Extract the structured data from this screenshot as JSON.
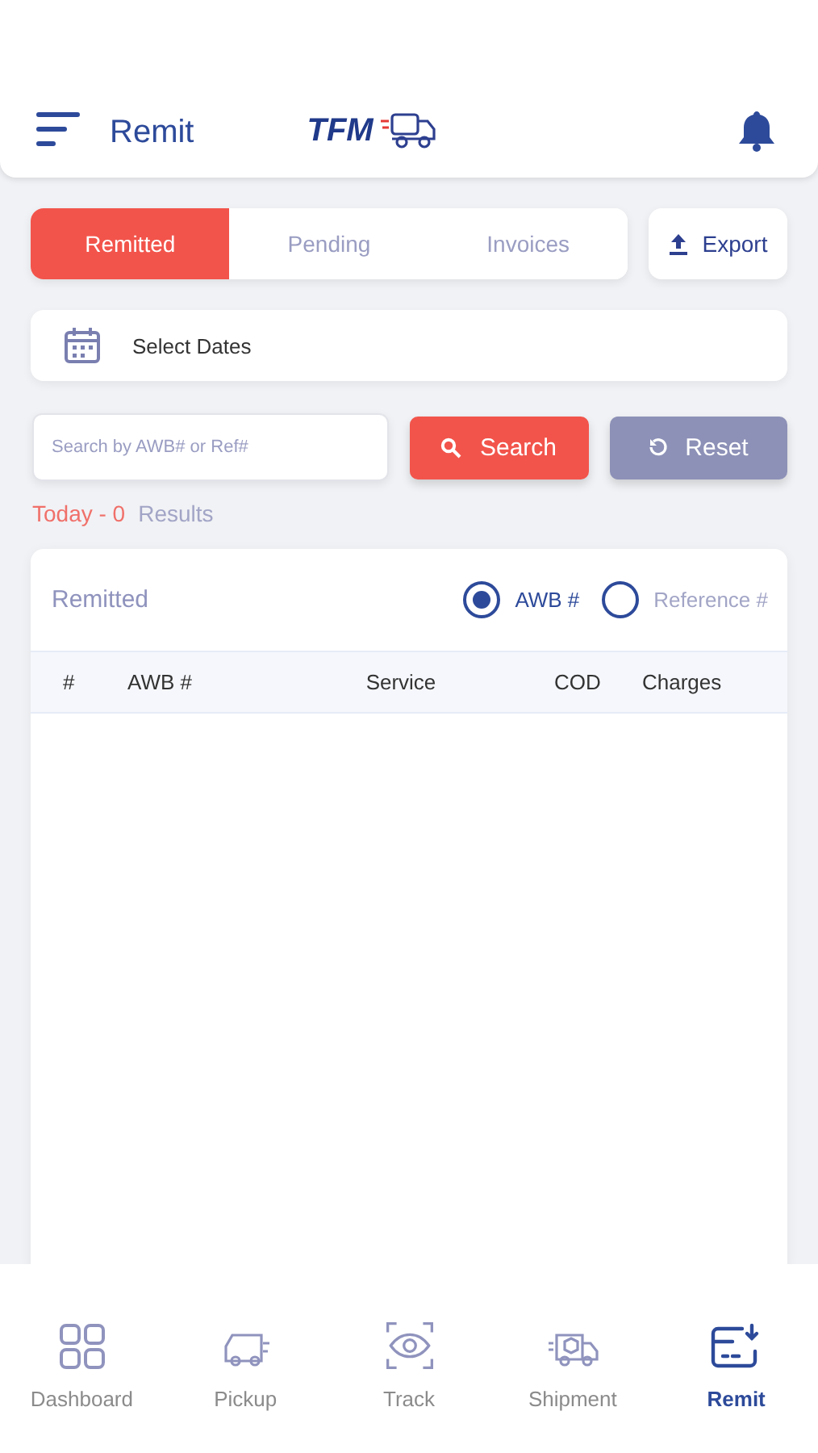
{
  "header": {
    "title": "Remit",
    "logo_text": "TFM"
  },
  "tabs": [
    {
      "label": "Remitted",
      "selected": true
    },
    {
      "label": "Pending",
      "selected": false
    },
    {
      "label": "Invoices",
      "selected": false
    }
  ],
  "export_button": "Export",
  "date_field": {
    "placeholder": "Select Dates"
  },
  "search": {
    "placeholder": "Search by AWB# or Ref#",
    "search_button": "Search",
    "reset_button": "Reset"
  },
  "result": {
    "period": "Today - 0",
    "label": "Results"
  },
  "card": {
    "title": "Remitted",
    "radios": [
      {
        "label": "AWB #",
        "selected": true
      },
      {
        "label": "Reference #",
        "selected": false
      }
    ]
  },
  "table": {
    "columns": [
      "#",
      "AWB #",
      "Service",
      "COD",
      "Charges"
    ]
  },
  "bottom_nav": [
    {
      "label": "Dashboard",
      "kind": "grid",
      "selected": false
    },
    {
      "label": "Pickup",
      "kind": "van",
      "selected": false
    },
    {
      "label": "Track",
      "kind": "eye",
      "selected": false
    },
    {
      "label": "Shipment",
      "kind": "truck",
      "selected": false
    },
    {
      "label": "Remit",
      "kind": "remit",
      "selected": true
    }
  ]
}
